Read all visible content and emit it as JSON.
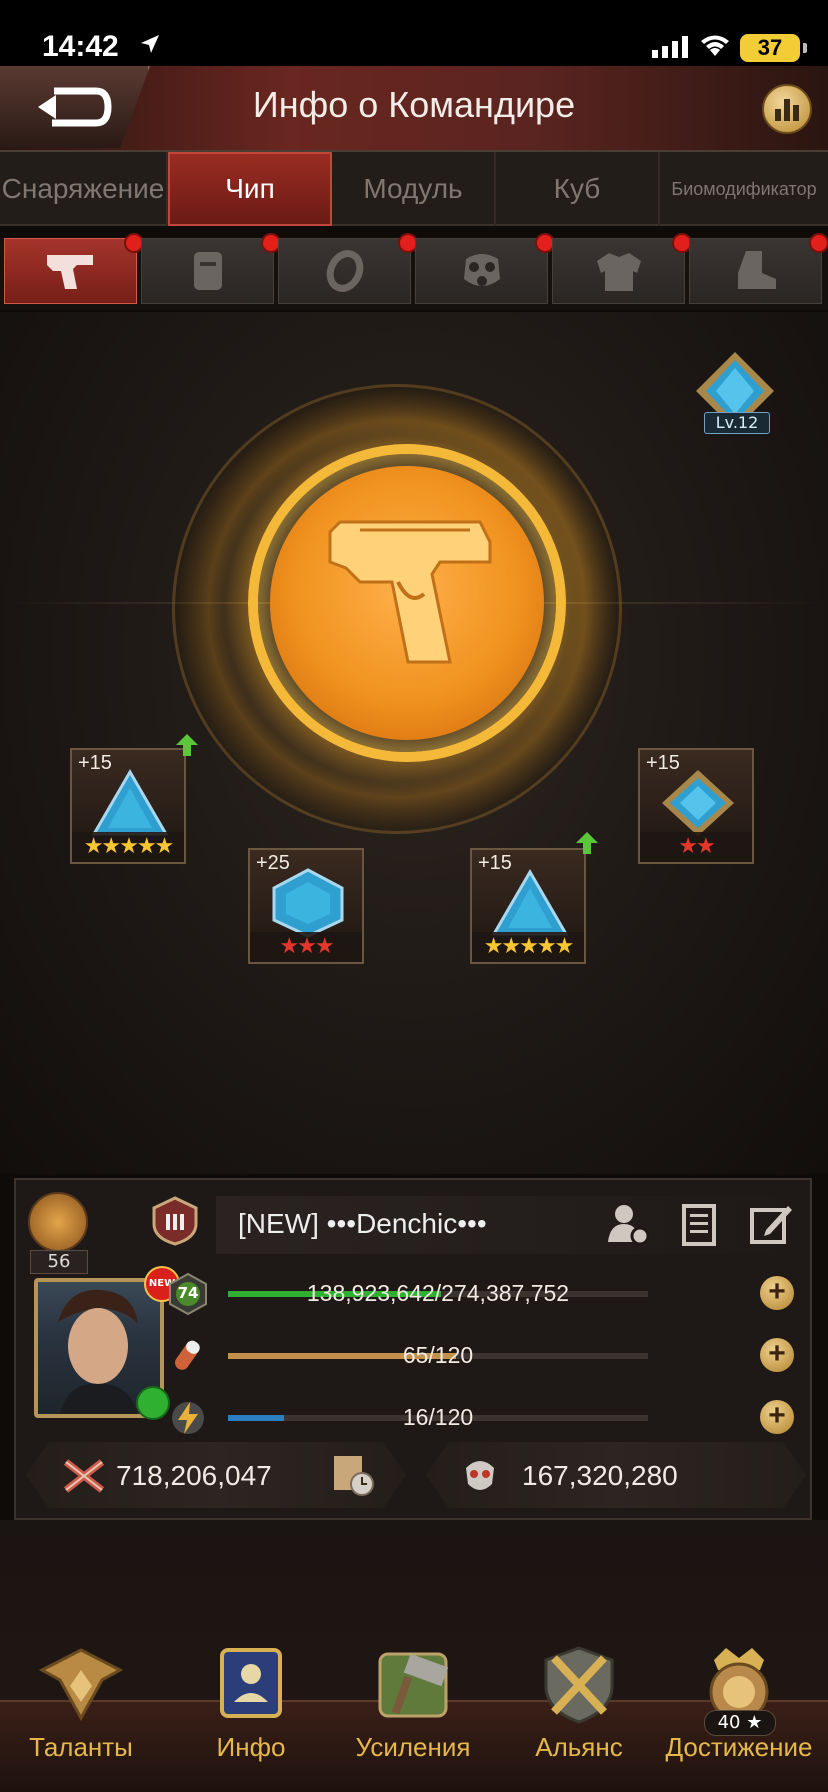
{
  "status_bar": {
    "time": "14:42",
    "battery": "37"
  },
  "header": {
    "title": "Инфо о Командире"
  },
  "tabs": [
    {
      "label": "Снаряжение",
      "active": false
    },
    {
      "label": "Чип",
      "active": true
    },
    {
      "label": "Модуль",
      "active": false
    },
    {
      "label": "Куб",
      "active": false
    },
    {
      "label": "Биомодификатор",
      "active": false
    }
  ],
  "slots": [
    {
      "icon": "pistol-icon",
      "active": true,
      "has_alert": true
    },
    {
      "icon": "vest-icon",
      "active": false,
      "has_alert": true
    },
    {
      "icon": "ring-icon",
      "active": false,
      "has_alert": true
    },
    {
      "icon": "gas-mask-icon",
      "active": false,
      "has_alert": true
    },
    {
      "icon": "armor-icon",
      "active": false,
      "has_alert": true
    },
    {
      "icon": "boot-icon",
      "active": false,
      "has_alert": true
    }
  ],
  "equipment": {
    "level_label": "Lv.12"
  },
  "chips": [
    {
      "plus": "+15",
      "stars": "★★★★★",
      "star_color": "gold",
      "shape": "triangle",
      "upgrade": true
    },
    {
      "plus": "+25",
      "stars": "★★★",
      "star_color": "red",
      "shape": "hexagon",
      "upgrade": false
    },
    {
      "plus": "+15",
      "stars": "★★★★★",
      "star_color": "gold",
      "shape": "triangle",
      "upgrade": true
    },
    {
      "plus": "+15",
      "stars": "★★",
      "star_color": "red",
      "shape": "diamond",
      "upgrade": false
    }
  ],
  "profile": {
    "rank_level": "56",
    "name": "[NEW]   •••Denchic•••",
    "new_badge": "NEW",
    "player_level": "74",
    "exp": {
      "text": "138,923,642/274,387,752",
      "fraction": 0.506,
      "color": "#2fb030"
    },
    "stamina": {
      "text": "65/120",
      "fraction": 0.542,
      "color": "#c4914a"
    },
    "energy": {
      "text": "16/120",
      "fraction": 0.133,
      "color": "#2a7fc0"
    },
    "power": "718,206,047",
    "kills": "167,320,280"
  },
  "nav": [
    {
      "label": "Таланты",
      "icon": "talents-icon"
    },
    {
      "label": "Инфо",
      "icon": "info-icon"
    },
    {
      "label": "Усиления",
      "icon": "boosts-icon"
    },
    {
      "label": "Альянс",
      "icon": "alliance-icon"
    },
    {
      "label": "Достижение",
      "icon": "achievement-icon",
      "count": "40 ★"
    }
  ]
}
